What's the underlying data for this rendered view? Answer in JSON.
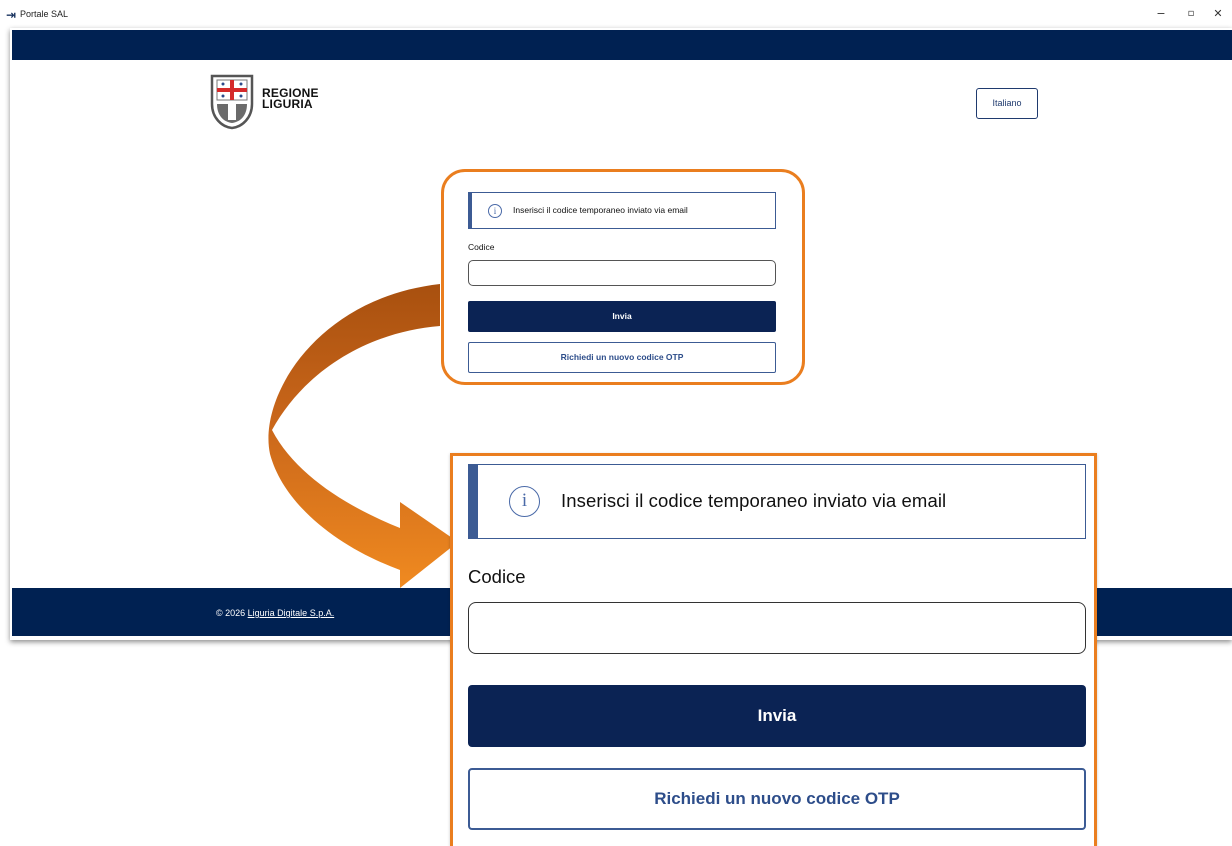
{
  "window": {
    "title": "Portale SAL",
    "minimize": "−",
    "maximize": "▫",
    "close": "✕"
  },
  "header": {
    "logo_line1": "REGIONE",
    "logo_line2": "LIGURIA",
    "language_button": "Italiano"
  },
  "form": {
    "info_icon": "i",
    "info_message": "Inserisci il codice temporaneo inviato via email",
    "code_label": "Codice",
    "code_value": "",
    "submit_label": "Invia",
    "otp_label": "Richiedi un nuovo codice OTP"
  },
  "footer": {
    "copyright": "© 2026 ",
    "company_link": "Liguria Digitale S.p.A."
  },
  "colors": {
    "navy": "#002152",
    "button_navy": "#0b2354",
    "accent_orange": "#ea7e1f",
    "info_blue": "#3c5b94"
  },
  "icons": {
    "app": "login-icon",
    "info": "info-circle-icon",
    "callout": "curved-arrow-icon"
  }
}
